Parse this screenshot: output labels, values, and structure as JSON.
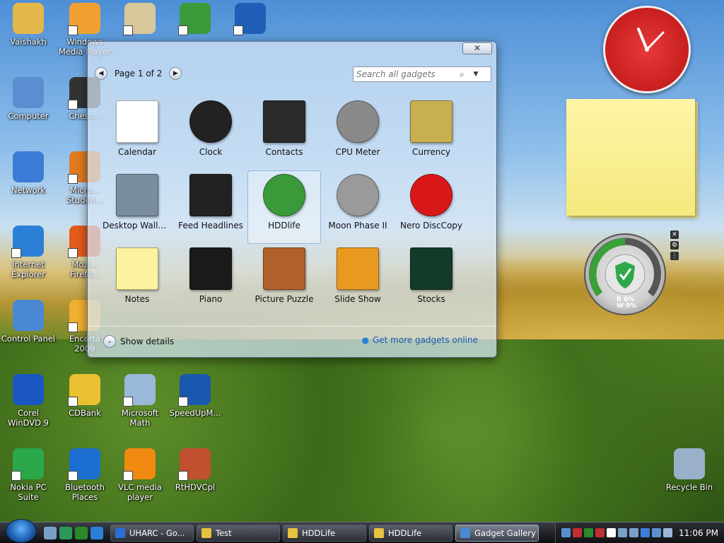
{
  "desktop_icons": [
    {
      "label": "Vaishakh",
      "color": "#e4b74a"
    },
    {
      "label": "Windows\nMedia Player",
      "color": "#f0a030"
    },
    {
      "label": "",
      "color": "#d8c79a"
    },
    {
      "label": "",
      "color": "#3a9a3a"
    },
    {
      "label": "",
      "color": "#1f5fb8"
    },
    {
      "label": "Computer",
      "color": "#5a8ed0"
    },
    {
      "label": "Chess...",
      "color": "#333333"
    },
    {
      "label": "Network",
      "color": "#3b7dd6"
    },
    {
      "label": "Micro...\nStuden...",
      "color": "#e07a20"
    },
    {
      "label": "Internet\nExplorer",
      "color": "#2b7fd6"
    },
    {
      "label": "Mozi...\nFirefo...",
      "color": "#e25b1c"
    },
    {
      "label": "Control Panel",
      "color": "#4a88d4"
    },
    {
      "label": "Encarta\n2009",
      "color": "#f0b030"
    },
    {
      "label": "Corel\nWinDVD 9",
      "color": "#1a56c0"
    },
    {
      "label": "CDBank",
      "color": "#e8c030"
    },
    {
      "label": "Microsoft\nMath",
      "color": "#9ab8d8"
    },
    {
      "label": "SpeedUpM...",
      "color": "#1a58b0"
    },
    {
      "label": "Nokia PC\nSuite",
      "color": "#2aa84a"
    },
    {
      "label": "Bluetooth\nPlaces",
      "color": "#1c6fd0"
    },
    {
      "label": "VLC media\nplayer",
      "color": "#f08a10"
    },
    {
      "label": "RtHDVCpl",
      "color": "#c05030"
    },
    {
      "label": "Recycle Bin",
      "color": "#9ab0c8"
    }
  ],
  "gallery": {
    "close_glyph": "✕",
    "prev_glyph": "◀",
    "next_glyph": "▶",
    "page_label": "Page 1 of 2",
    "search_placeholder": "Search all gadgets",
    "search_glyph": "⌕",
    "dropdown_glyph": "▼",
    "gadgets": [
      {
        "label": "Calendar",
        "icon": "calendar-icon",
        "color": "#ffffff",
        "selected": false
      },
      {
        "label": "Clock",
        "icon": "clock-icon",
        "color": "#222222",
        "selected": false
      },
      {
        "label": "Contacts",
        "icon": "contacts-icon",
        "color": "#2a2a2a",
        "selected": false
      },
      {
        "label": "CPU Meter",
        "icon": "cpu-meter-icon",
        "color": "#8a8a8a",
        "selected": false
      },
      {
        "label": "Currency",
        "icon": "currency-icon",
        "color": "#c8b050",
        "selected": false
      },
      {
        "label": "Desktop Wallpa...",
        "icon": "wallpaper-icon",
        "color": "#7a8ea0",
        "selected": false
      },
      {
        "label": "Feed Headlines",
        "icon": "feed-icon",
        "color": "#222222",
        "selected": false
      },
      {
        "label": "HDDlife",
        "icon": "hddlife-icon",
        "color": "#3a9a3a",
        "selected": true
      },
      {
        "label": "Moon Phase II",
        "icon": "moon-icon",
        "color": "#9a9a9a",
        "selected": false
      },
      {
        "label": "Nero DiscCopy",
        "icon": "nero-icon",
        "color": "#d81818",
        "selected": false
      },
      {
        "label": "Notes",
        "icon": "notes-icon",
        "color": "#fbf3a0",
        "selected": false
      },
      {
        "label": "Piano",
        "icon": "piano-icon",
        "color": "#1a1a1a",
        "selected": false
      },
      {
        "label": "Picture Puzzle",
        "icon": "puzzle-icon",
        "color": "#b0602a",
        "selected": false
      },
      {
        "label": "Slide Show",
        "icon": "slideshow-icon",
        "color": "#e89a20",
        "selected": false
      },
      {
        "label": "Stocks",
        "icon": "stocks-icon",
        "color": "#143a2a",
        "selected": false
      }
    ],
    "show_details": "Show details",
    "more_link": "Get more gadgets online"
  },
  "hdd_widget": {
    "r_label": "R 0%",
    "w_label": "W 0%"
  },
  "taskbar": {
    "tasks": [
      {
        "label": "UHARC - Go...",
        "color": "#2a6fd6",
        "active": false
      },
      {
        "label": "Test",
        "color": "#e8c040",
        "active": false
      },
      {
        "label": "HDDLife",
        "color": "#e8c040",
        "active": false
      },
      {
        "label": "HDDLife",
        "color": "#e8c040",
        "active": false
      },
      {
        "label": "Gadget Gallery",
        "color": "#4a8ad0",
        "active": true
      }
    ],
    "quick_launch_colors": [
      "#7aa0c8",
      "#2a9a5a",
      "#2a8a2a",
      "#2a7fd6"
    ],
    "tray_colors": [
      "#5a90d0",
      "#c03030",
      "#2a8a2a",
      "#c03030",
      "#ffffff",
      "#7aa0c8",
      "#7aa0c8",
      "#3a7fd6",
      "#5a90d0",
      "#9ab8d8"
    ],
    "time": "11:06 PM"
  }
}
